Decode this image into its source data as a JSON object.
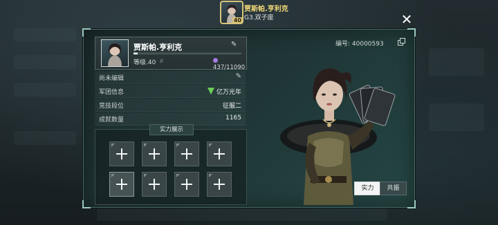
{
  "header": {
    "player_name": "贾斯帕.亨利克",
    "sub_title": "G3.双子座",
    "avatar_level": "40"
  },
  "profile": {
    "name": "贾斯帕.亨利克",
    "level": "等级.40",
    "level_deco": "////",
    "exp": "437/11090",
    "exp_progress": 0.04
  },
  "rows": [
    {
      "key": "尚未编辑",
      "value": ""
    },
    {
      "key": "军团信息",
      "value": "亿万光年"
    },
    {
      "key": "竞技段位",
      "value": "征服二"
    },
    {
      "key": "成就数量",
      "value": "1165"
    }
  ],
  "showcase": {
    "title": "实力展示",
    "slot_count": 8
  },
  "id_label": "编号: 40000593",
  "tabs": {
    "shili": "实力",
    "gongzhen": "共振"
  },
  "icons": {
    "close": "close-icon",
    "edit": "pencil-icon",
    "copy": "copy-icon",
    "add": "plus-icon",
    "guild": "guild-emblem-icon",
    "gem": "gem-icon"
  },
  "colors": {
    "accent_gold": "#f0d778",
    "panel_border": "#4a6b68",
    "guild_green": "#6ccf5a",
    "gem_purple": "#a47be0"
  }
}
